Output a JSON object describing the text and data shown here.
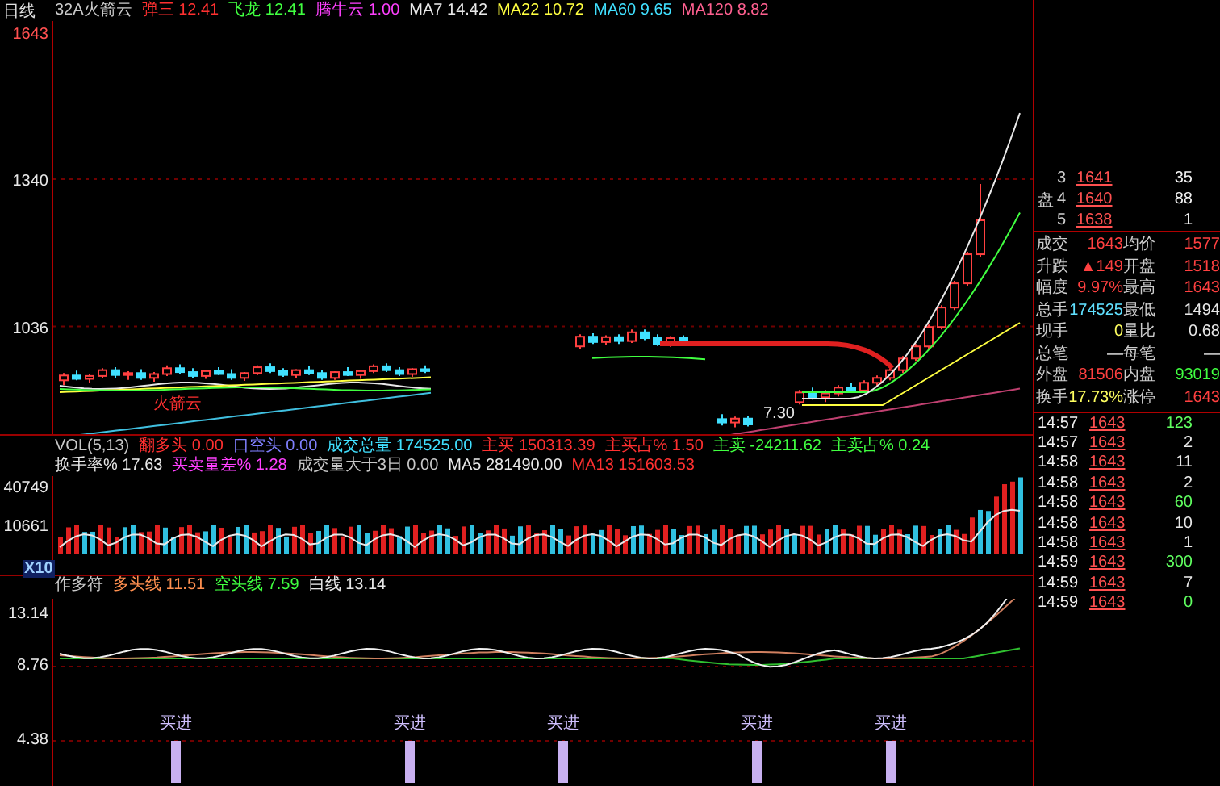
{
  "period_label": "日线",
  "price_legend": [
    {
      "text": "32A火箭云",
      "color": "#c8c8c8"
    },
    {
      "text": "弹三 12.41",
      "color": "#ff3030"
    },
    {
      "text": "飞龙 12.41",
      "color": "#40ff40"
    },
    {
      "text": "腾牛云 1.00",
      "color": "#ff40ff"
    },
    {
      "text": "MA7 14.42",
      "color": "#e8e8e8"
    },
    {
      "text": "MA22 10.72",
      "color": "#ffff40"
    },
    {
      "text": "MA60 9.65",
      "color": "#40e0ff"
    },
    {
      "text": "MA120 8.82",
      "color": "#ff6090"
    }
  ],
  "price_chart": {
    "chart_data": {
      "type": "candlestick",
      "yticks": [
        1643,
        1340,
        1036
      ],
      "ylim": [
        814,
        1666
      ],
      "ohlc": [
        [
          925,
          940,
          915,
          935
        ],
        [
          935,
          945,
          925,
          928
        ],
        [
          928,
          938,
          920,
          934
        ],
        [
          934,
          950,
          930,
          946
        ],
        [
          946,
          952,
          930,
          936
        ],
        [
          936,
          944,
          926,
          940
        ],
        [
          940,
          948,
          926,
          930
        ],
        [
          930,
          942,
          922,
          938
        ],
        [
          938,
          956,
          934,
          950
        ],
        [
          950,
          958,
          938,
          942
        ],
        [
          942,
          950,
          930,
          934
        ],
        [
          934,
          946,
          928,
          944
        ],
        [
          944,
          952,
          936,
          938
        ],
        [
          938,
          948,
          926,
          930
        ],
        [
          930,
          942,
          924,
          940
        ],
        [
          940,
          956,
          936,
          952
        ],
        [
          952,
          960,
          940,
          944
        ],
        [
          944,
          950,
          932,
          936
        ],
        [
          936,
          948,
          930,
          946
        ],
        [
          946,
          954,
          936,
          940
        ],
        [
          940,
          946,
          926,
          930
        ],
        [
          930,
          944,
          926,
          942
        ],
        [
          942,
          952,
          934,
          936
        ],
        [
          936,
          946,
          928,
          944
        ],
        [
          944,
          958,
          940,
          954
        ],
        [
          954,
          960,
          942,
          946
        ],
        [
          946,
          952,
          934,
          938
        ],
        [
          938,
          950,
          932,
          948
        ],
        [
          948,
          956,
          940,
          944
        ],
        null,
        null,
        null,
        null,
        null,
        null,
        null,
        null,
        null,
        null,
        null,
        [
          995,
          1020,
          990,
          1015
        ],
        [
          1015,
          1022,
          1000,
          1004
        ],
        [
          1004,
          1018,
          998,
          1014
        ],
        [
          1014,
          1020,
          1000,
          1006
        ],
        [
          1006,
          1030,
          1002,
          1024
        ],
        [
          1024,
          1030,
          1008,
          1012
        ],
        [
          1012,
          1020,
          996,
          1000
        ],
        [
          1000,
          1016,
          994,
          1012
        ],
        [
          1012,
          1018,
          998,
          1004
        ],
        null,
        null,
        [
          845,
          855,
          832,
          838
        ],
        [
          838,
          850,
          828,
          846
        ],
        [
          846,
          852,
          830,
          834
        ],
        null,
        null,
        null,
        [
          880,
          905,
          875,
          900
        ],
        [
          900,
          910,
          885,
          890
        ],
        [
          890,
          905,
          880,
          898
        ],
        [
          898,
          915,
          892,
          910
        ],
        [
          910,
          920,
          900,
          904
        ],
        [
          904,
          925,
          900,
          920
        ],
        [
          920,
          935,
          912,
          930
        ],
        [
          930,
          950,
          925,
          946
        ],
        [
          946,
          975,
          940,
          970
        ],
        [
          970,
          1000,
          965,
          995
        ],
        [
          995,
          1040,
          990,
          1035
        ],
        [
          1035,
          1080,
          1030,
          1075
        ],
        [
          1075,
          1130,
          1070,
          1125
        ],
        [
          1125,
          1190,
          1120,
          1185
        ],
        [
          1185,
          1330,
          1180,
          1255
        ]
      ]
    },
    "labels": [
      "火箭云",
      "7.30"
    ]
  },
  "volume_legend": [
    {
      "text": "VOL(5,13)",
      "color": "#c8c8c8"
    },
    {
      "text": "翻多头 0.00",
      "color": "#ff3030"
    },
    {
      "text": "口空头 0.00",
      "color": "#8080ff"
    },
    {
      "text": "成交总量 174525.00",
      "color": "#40e0ff"
    },
    {
      "text": "主买 150313.39",
      "color": "#ff3030"
    },
    {
      "text": "主买占% 1.50",
      "color": "#ff3030"
    },
    {
      "text": "主卖 -24211.62",
      "color": "#40ff40"
    },
    {
      "text": "主卖占% 0.24",
      "color": "#40ff40"
    },
    {
      "text": "换手率% 17.63",
      "color": "#e8e8e8"
    },
    {
      "text": "买卖量差% 1.28",
      "color": "#ff40ff"
    },
    {
      "text": "成交量大于3日 0.00",
      "color": "#c8c8c8"
    },
    {
      "text": "MA5 281490.00",
      "color": "#e8e8e8"
    },
    {
      "text": "MA13 151603.53",
      "color": "#ff3030"
    }
  ],
  "volume_axis": [
    "40749",
    "10661"
  ],
  "volume_scale": "X10",
  "indicator_legend": [
    {
      "text": "作多符",
      "color": "#c8c8c8"
    },
    {
      "text": "多头线 11.51",
      "color": "#ff9050"
    },
    {
      "text": "空头线 7.59",
      "color": "#40ff40"
    },
    {
      "text": "白线 13.14",
      "color": "#e8e8e8"
    }
  ],
  "indicator_axis": [
    "13.14",
    "8.76",
    "4.38"
  ],
  "buy_signals": [
    "买进",
    "买进",
    "买进",
    "买进",
    "买进"
  ],
  "order_book": {
    "side_label": "盘",
    "rows": [
      {
        "num": "3",
        "price": "1641",
        "volume": "35"
      },
      {
        "num": "4",
        "price": "1640",
        "volume": "88"
      },
      {
        "num": "5",
        "price": "1638",
        "volume": "1"
      }
    ]
  },
  "quote_stats": [
    {
      "left": {
        "label": "成交",
        "value": "1643",
        "color": "#ff4040"
      },
      "right": {
        "label": "均价",
        "value": "1577",
        "color": "#ff4040"
      }
    },
    {
      "left": {
        "label": "升跌",
        "value": "▲149",
        "color": "#ff4040"
      },
      "right": {
        "label": "开盘",
        "value": "1518",
        "color": "#ff4040"
      }
    },
    {
      "left": {
        "label": "幅度",
        "value": "9.97%",
        "color": "#ff4040"
      },
      "right": {
        "label": "最高",
        "value": "1643",
        "color": "#ff4040"
      }
    },
    {
      "left": {
        "label": "总手",
        "value": "174525",
        "color": "#60e0ff"
      },
      "right": {
        "label": "最低",
        "value": "1494",
        "color": "#e8e8e8"
      }
    },
    {
      "left": {
        "label": "现手",
        "value": "0",
        "color": "#ffff60"
      },
      "right": {
        "label": "量比",
        "value": "0.68",
        "color": "#e8e8e8"
      }
    },
    {
      "left": {
        "label": "总笔",
        "value": "—"
      },
      "right": {
        "label": "每笔",
        "value": "—"
      }
    },
    {
      "left": {
        "label": "外盘",
        "value": "81506",
        "color": "#ff4040"
      },
      "right": {
        "label": "内盘",
        "value": "93019",
        "color": "#40ff40"
      }
    },
    {
      "left": {
        "label": "换手",
        "value": "17.73%",
        "color": "#ffff60"
      },
      "right": {
        "label": "涨停",
        "value": "1643",
        "color": "#ff4040"
      }
    }
  ],
  "ticks": [
    {
      "time": "14:57",
      "price": "1643",
      "volume": "123",
      "color": "#60ff60"
    },
    {
      "time": "14:57",
      "price": "1643",
      "volume": "2",
      "color": "#e8e8e8"
    },
    {
      "time": "14:58",
      "price": "1643",
      "volume": "11",
      "color": "#e8e8e8"
    },
    {
      "time": "14:58",
      "price": "1643",
      "volume": "2",
      "color": "#e8e8e8"
    },
    {
      "time": "14:58",
      "price": "1643",
      "volume": "60",
      "color": "#60ff60"
    },
    {
      "time": "14:58",
      "price": "1643",
      "volume": "10",
      "color": "#e8e8e8"
    },
    {
      "time": "14:58",
      "price": "1643",
      "volume": "1",
      "color": "#e8e8e8"
    },
    {
      "time": "14:59",
      "price": "1643",
      "volume": "300",
      "color": "#60ff60"
    },
    {
      "time": "14:59",
      "price": "1643",
      "volume": "7",
      "color": "#e8e8e8"
    },
    {
      "time": "14:59",
      "price": "1643",
      "volume": "0",
      "color": "#60ff60"
    }
  ]
}
